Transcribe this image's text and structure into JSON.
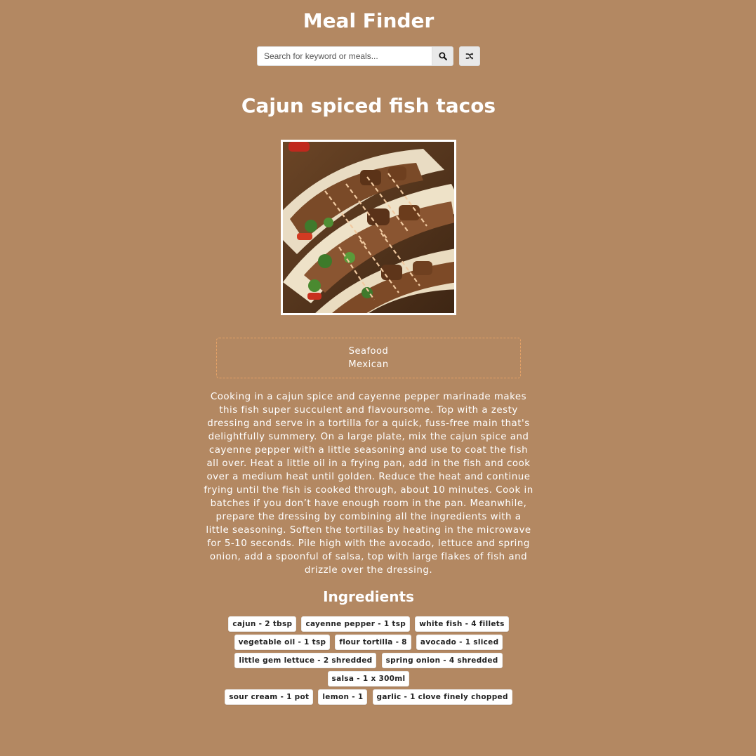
{
  "header": {
    "title": "Meal Finder"
  },
  "search": {
    "placeholder": "Search for keyword or meals...",
    "value": "",
    "search_icon": "search-icon",
    "random_icon": "shuffle-icon"
  },
  "meal": {
    "title": "Cajun spiced fish tacos",
    "image_alt": "Cajun spiced fish tacos",
    "category": "Seafood",
    "area": "Mexican",
    "instructions": "Cooking in a cajun spice and cayenne pepper marinade makes this fish super succulent and flavoursome. Top with a zesty dressing and serve in a tortilla for a quick, fuss-free main that's delightfully summery. On a large plate, mix the cajun spice and cayenne pepper with a little seasoning and use to coat the fish all over. Heat a little oil in a frying pan, add in the fish and cook over a medium heat until golden. Reduce the heat and continue frying until the fish is cooked through, about 10 minutes. Cook in batches if you don’t have enough room in the pan. Meanwhile, prepare the dressing by combining all the ingredients with a little seasoning. Soften the tortillas by heating in the microwave for 5-10 seconds. Pile high with the avocado, lettuce and spring onion, add a spoonful of salsa, top with large flakes of fish and drizzle over the dressing.",
    "ingredients_heading": "Ingredients",
    "ingredients": [
      "cajun - 2 tbsp",
      "cayenne pepper - 1 tsp",
      "white fish - 4 fillets",
      "vegetable oil - 1 tsp",
      "flour tortilla - 8",
      "avocado - 1 sliced",
      "little gem lettuce - 2 shredded",
      "spring onion - 4 shredded",
      "salsa - 1 x 300ml",
      "sour cream - 1 pot",
      "lemon - 1",
      "garlic - 1 clove finely chopped"
    ]
  },
  "colors": {
    "background": "#b38862",
    "text": "#ffffff",
    "info_border": "#e6a266",
    "chip_background": "#ffffff",
    "chip_text": "#222222"
  }
}
